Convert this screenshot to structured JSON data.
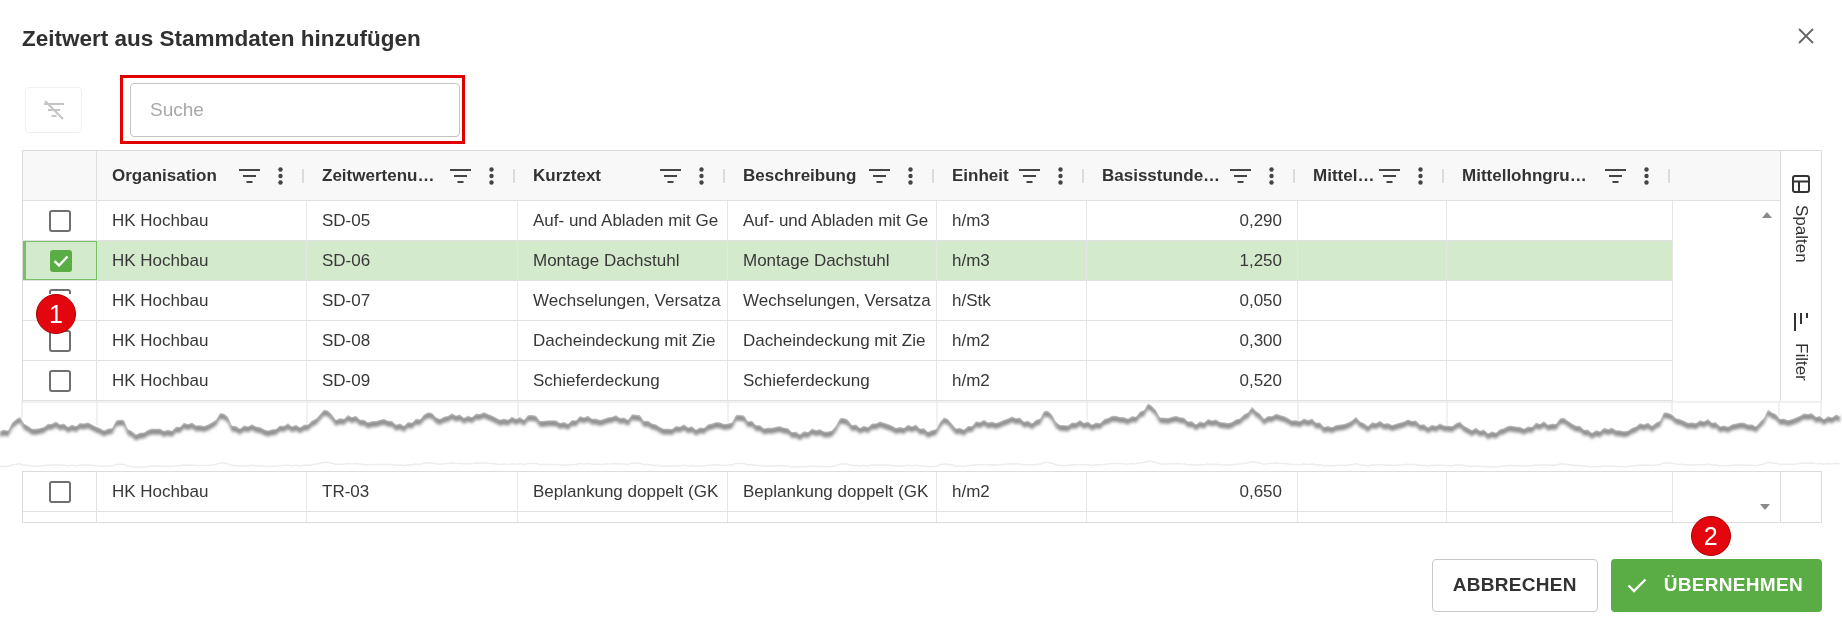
{
  "dialog": {
    "title": "Zeitwert aus Stammdaten hinzufügen"
  },
  "toolbar": {
    "clear_filters_button": {
      "disabled": true
    },
    "search": {
      "placeholder": "Suche",
      "highlighted": true
    }
  },
  "table": {
    "columns": [
      {
        "label": "Organisation",
        "kind": "text"
      },
      {
        "label": "Zeitwertenu…",
        "kind": "text"
      },
      {
        "label": "Kurztext",
        "kind": "text"
      },
      {
        "label": "Beschreibung",
        "kind": "text"
      },
      {
        "label": "Einheit",
        "kind": "text"
      },
      {
        "label": "Basisstunde…",
        "kind": "number"
      },
      {
        "label": "Mittel…",
        "kind": "text"
      },
      {
        "label": "Mittellohngru…",
        "kind": "text"
      }
    ],
    "rows": [
      {
        "kind": "row",
        "selected": false,
        "cells": [
          "HK Hochbau",
          "SD-05",
          "Auf- und Abladen mit Ge",
          "Auf- und Abladen mit Ge",
          "h/m3",
          "0,290"
        ]
      },
      {
        "kind": "row",
        "selected": true,
        "cells": [
          "HK Hochbau",
          "SD-06",
          "Montage Dachstuhl",
          "Montage Dachstuhl",
          "h/m3",
          "1,250"
        ]
      },
      {
        "kind": "row",
        "selected": false,
        "callout": "1",
        "cells": [
          "HK Hochbau",
          "SD-07",
          "Wechselungen, Versatza",
          "Wechselungen, Versatza",
          "h/Stk",
          "0,050"
        ]
      },
      {
        "kind": "row",
        "selected": false,
        "cells": [
          "HK Hochbau",
          "SD-08",
          "Dacheindeckung mit Zie",
          "Dacheindeckung mit Zie",
          "h/m2",
          "0,300"
        ]
      },
      {
        "kind": "row",
        "selected": false,
        "cells": [
          "HK Hochbau",
          "SD-09",
          "Schieferdeckung",
          "Schieferdeckung",
          "h/m2",
          "0,520"
        ]
      },
      {
        "kind": "tear"
      },
      {
        "kind": "row",
        "selected": false,
        "cells": [
          "HK Hochbau",
          "TR-03",
          "Beplankung doppelt (GK",
          "Beplankung doppelt (GK",
          "h/m2",
          "0,650"
        ]
      }
    ],
    "side_panel": {
      "tabs": [
        {
          "label": "Spalten",
          "kind": "columns"
        },
        {
          "label": "Filter",
          "kind": "filter"
        }
      ]
    }
  },
  "footer": {
    "buttons": [
      {
        "label": "ABBRECHEN",
        "kind": "secondary"
      },
      {
        "label": "ÜBERNEHMEN",
        "kind": "primary",
        "callout": "2"
      }
    ]
  }
}
